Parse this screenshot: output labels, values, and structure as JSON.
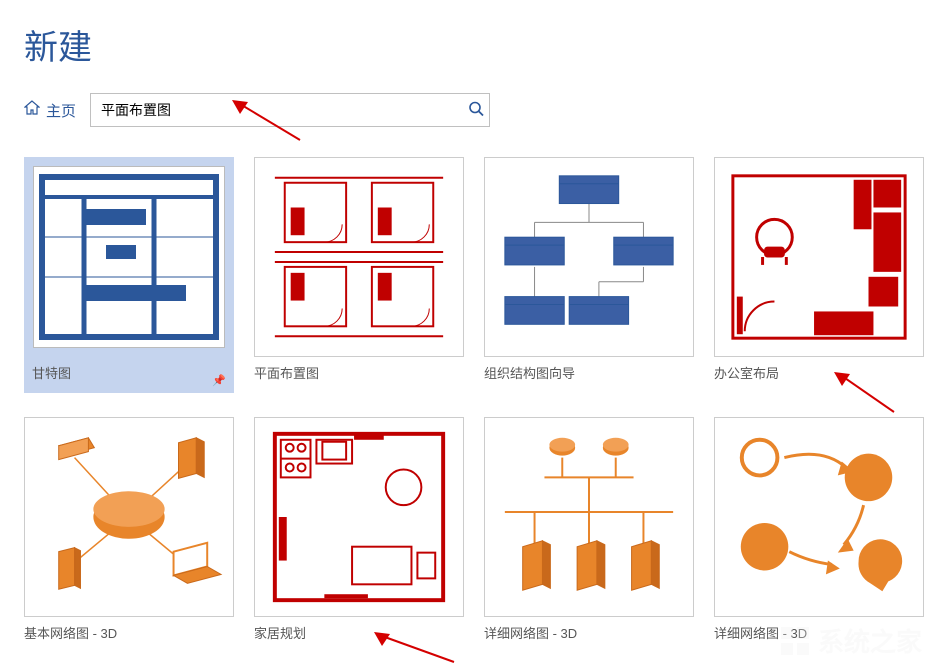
{
  "pageTitle": "新建",
  "home": {
    "label": "主页"
  },
  "search": {
    "value": "平面布置图"
  },
  "templates": [
    {
      "label": "甘特图"
    },
    {
      "label": "平面布置图"
    },
    {
      "label": "组织结构图向导"
    },
    {
      "label": "办公室布局"
    },
    {
      "label": "基本网络图 - 3D"
    },
    {
      "label": "家居规划"
    },
    {
      "label": "详细网络图 - 3D"
    },
    {
      "label": "详细网络图 - 3D"
    }
  ],
  "watermark": {
    "text": "系统之家"
  }
}
